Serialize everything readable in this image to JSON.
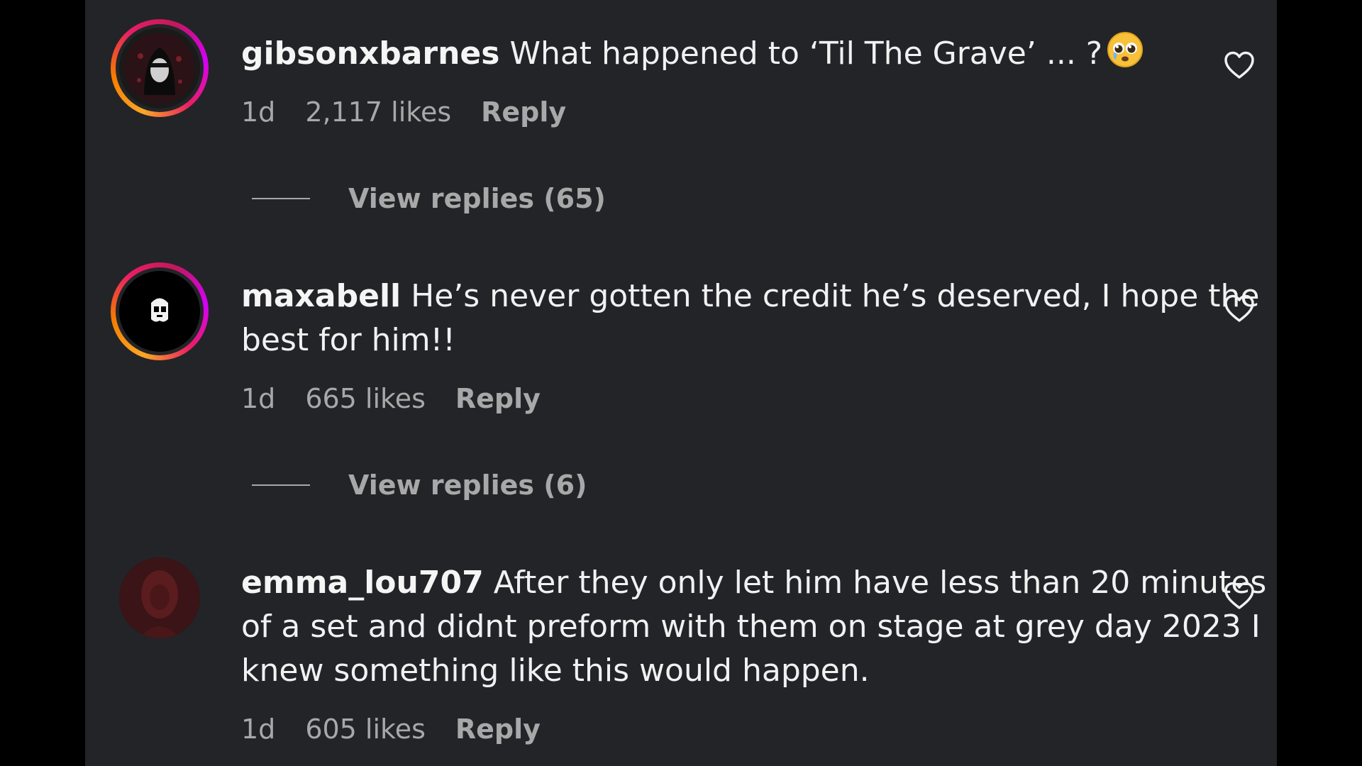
{
  "comments": [
    {
      "username": "gibsonxbarnes",
      "text": "What happened to ‘Til The Grave’ ... ?",
      "time": "1d",
      "likes": "2,117 likes",
      "reply_label": "Reply",
      "view_replies": "View replies (65)"
    },
    {
      "username": "maxabell",
      "text": "He’s never gotten the credit he’s deserved, I hope the best for him!!",
      "time": "1d",
      "likes": "665 likes",
      "reply_label": "Reply",
      "view_replies": "View replies (6)"
    },
    {
      "username": "emma_lou707",
      "text": "After they only let him have less than 20 minutes of a set and didnt preform with them on stage at grey day 2023 I knew something like this would happen.",
      "time": "1d",
      "likes": "605 likes",
      "reply_label": "Reply"
    }
  ],
  "icons": {
    "like": "heart-outline-icon",
    "emoji": "pleading-face-emoji"
  },
  "colors": {
    "background": "#232428",
    "text": "#f1f1f1",
    "meta": "#a8a8a8",
    "story_ring_start": "#f9a825",
    "story_ring_end": "#d500f9"
  }
}
